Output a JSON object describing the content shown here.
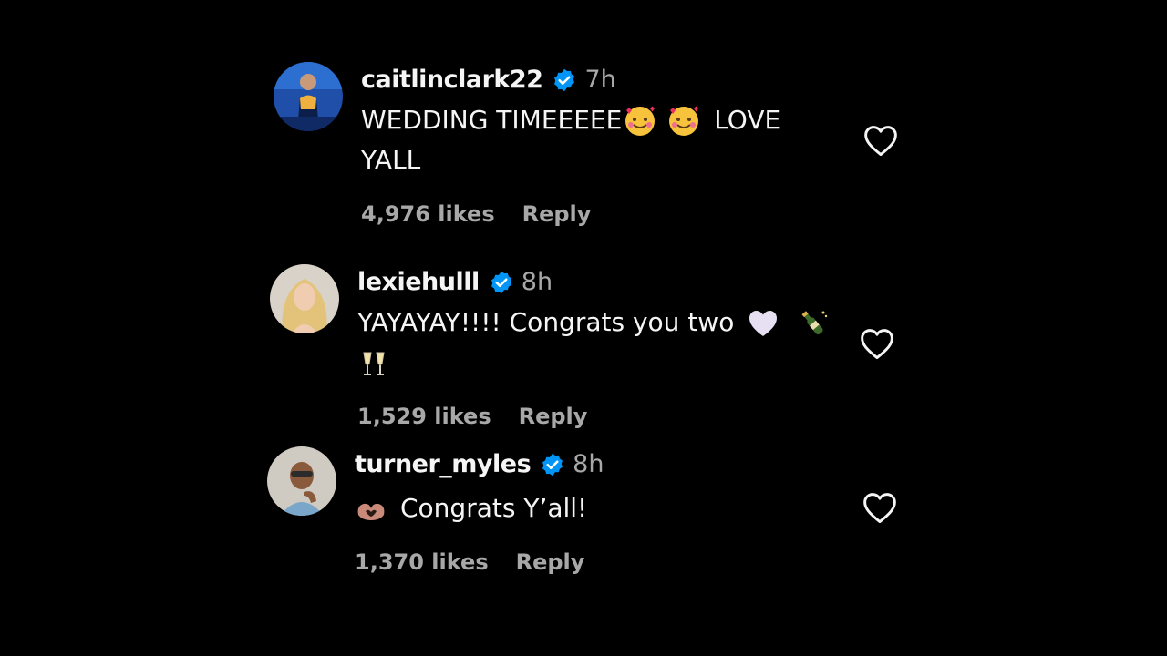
{
  "comments": [
    {
      "avatar_icon": "avatar-basketball-player",
      "username": "caitlinclark22",
      "verified_icon": "verified-badge-icon",
      "time": "7h",
      "text_part1": "WEDDING TIMEEEEE",
      "emoji1": "smiling-face-with-hearts-emoji",
      "emoji2": "smiling-face-with-hearts-emoji",
      "text_part2": "LOVE",
      "text_line2": "YALL",
      "likes": "4,976 likes",
      "reply": "Reply",
      "like_icon": "heart-outline-icon"
    },
    {
      "avatar_icon": "avatar-blonde-woman",
      "username": "lexiehulll",
      "verified_icon": "verified-badge-icon",
      "time": "8h",
      "text_part1": "YAYAYAY!!!! Congrats you two",
      "emoji1": "white-heart-emoji",
      "emoji2": "champagne-bottle-emoji",
      "emoji3": "clinking-glasses-emoji",
      "likes": "1,529 likes",
      "reply": "Reply",
      "like_icon": "heart-outline-icon"
    },
    {
      "avatar_icon": "avatar-man-sunglasses",
      "username": "turner_myles",
      "verified_icon": "verified-badge-icon",
      "time": "8h",
      "emoji1": "heart-hands-emoji",
      "text_part1": "Congrats Y’all!",
      "likes": "1,370 likes",
      "reply": "Reply",
      "like_icon": "heart-outline-icon"
    }
  ],
  "colors": {
    "background": "#000000",
    "text_primary": "#f5f5f5",
    "text_secondary": "#a8a8a8",
    "verified_blue": "#0095f6"
  }
}
